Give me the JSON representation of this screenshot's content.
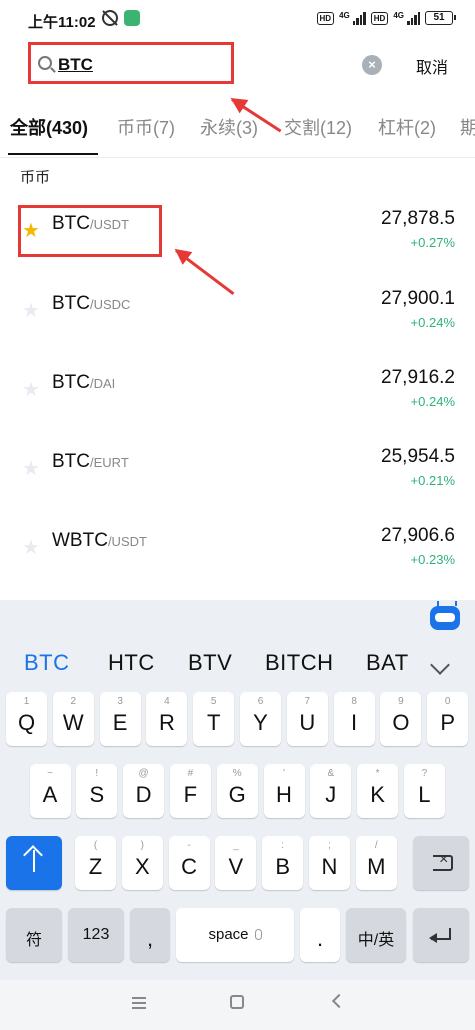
{
  "status_bar": {
    "time": "上午11:02",
    "hd1": "HD",
    "gen1": "4G",
    "hd2": "HD",
    "gen2": "4G",
    "battery": "51"
  },
  "search": {
    "value": "BTC",
    "cancel_label": "取消",
    "clear_icon": "close-circle-icon"
  },
  "tabs": [
    {
      "label": "全部(430)",
      "active": true
    },
    {
      "label": "币币(7)"
    },
    {
      "label": "永续(3)"
    },
    {
      "label": "交割(12)"
    },
    {
      "label": "杠杆(2)"
    },
    {
      "label": "期"
    }
  ],
  "section_title": "币币",
  "markets": [
    {
      "base": "BTC",
      "quote": "/USDT",
      "price": "27,878.5",
      "change": "+0.27%",
      "favorite": true
    },
    {
      "base": "BTC",
      "quote": "/USDC",
      "price": "27,900.1",
      "change": "+0.24%",
      "favorite": false
    },
    {
      "base": "BTC",
      "quote": "/DAI",
      "price": "27,916.2",
      "change": "+0.24%",
      "favorite": false
    },
    {
      "base": "BTC",
      "quote": "/EURT",
      "price": "25,954.5",
      "change": "+0.21%",
      "favorite": false
    },
    {
      "base": "WBTC",
      "quote": "/USDT",
      "price": "27,906.6",
      "change": "+0.23%",
      "favorite": false
    }
  ],
  "keyboard": {
    "suggestions": [
      "BTC",
      "HTC",
      "BTV",
      "BITCH",
      "BAT"
    ],
    "row1": [
      {
        "k": "Q",
        "s": "1"
      },
      {
        "k": "W",
        "s": "2"
      },
      {
        "k": "E",
        "s": "3"
      },
      {
        "k": "R",
        "s": "4"
      },
      {
        "k": "T",
        "s": "5"
      },
      {
        "k": "Y",
        "s": "6"
      },
      {
        "k": "U",
        "s": "7"
      },
      {
        "k": "I",
        "s": "8"
      },
      {
        "k": "O",
        "s": "9"
      },
      {
        "k": "P",
        "s": "0"
      }
    ],
    "row2": [
      {
        "k": "A",
        "s": "~"
      },
      {
        "k": "S",
        "s": "!"
      },
      {
        "k": "D",
        "s": "@"
      },
      {
        "k": "F",
        "s": "#"
      },
      {
        "k": "G",
        "s": "%"
      },
      {
        "k": "H",
        "s": "'"
      },
      {
        "k": "J",
        "s": "&"
      },
      {
        "k": "K",
        "s": "*"
      },
      {
        "k": "L",
        "s": "?"
      }
    ],
    "row3": [
      {
        "k": "Z",
        "s": "("
      },
      {
        "k": "X",
        "s": ")"
      },
      {
        "k": "C",
        "s": "-"
      },
      {
        "k": "V",
        "s": "_"
      },
      {
        "k": "B",
        "s": ":"
      },
      {
        "k": "N",
        "s": ";"
      },
      {
        "k": "M",
        "s": "/"
      }
    ],
    "symbol_key": "符",
    "num_key": "123",
    "emoji_key": ",",
    "space_key": "space",
    "period_key": ".",
    "lang_key": "中/英",
    "colors": {
      "accent": "#1a73e8",
      "up": "#2db37a",
      "highlight": "#e53935",
      "favorite": "#f5b800"
    }
  }
}
